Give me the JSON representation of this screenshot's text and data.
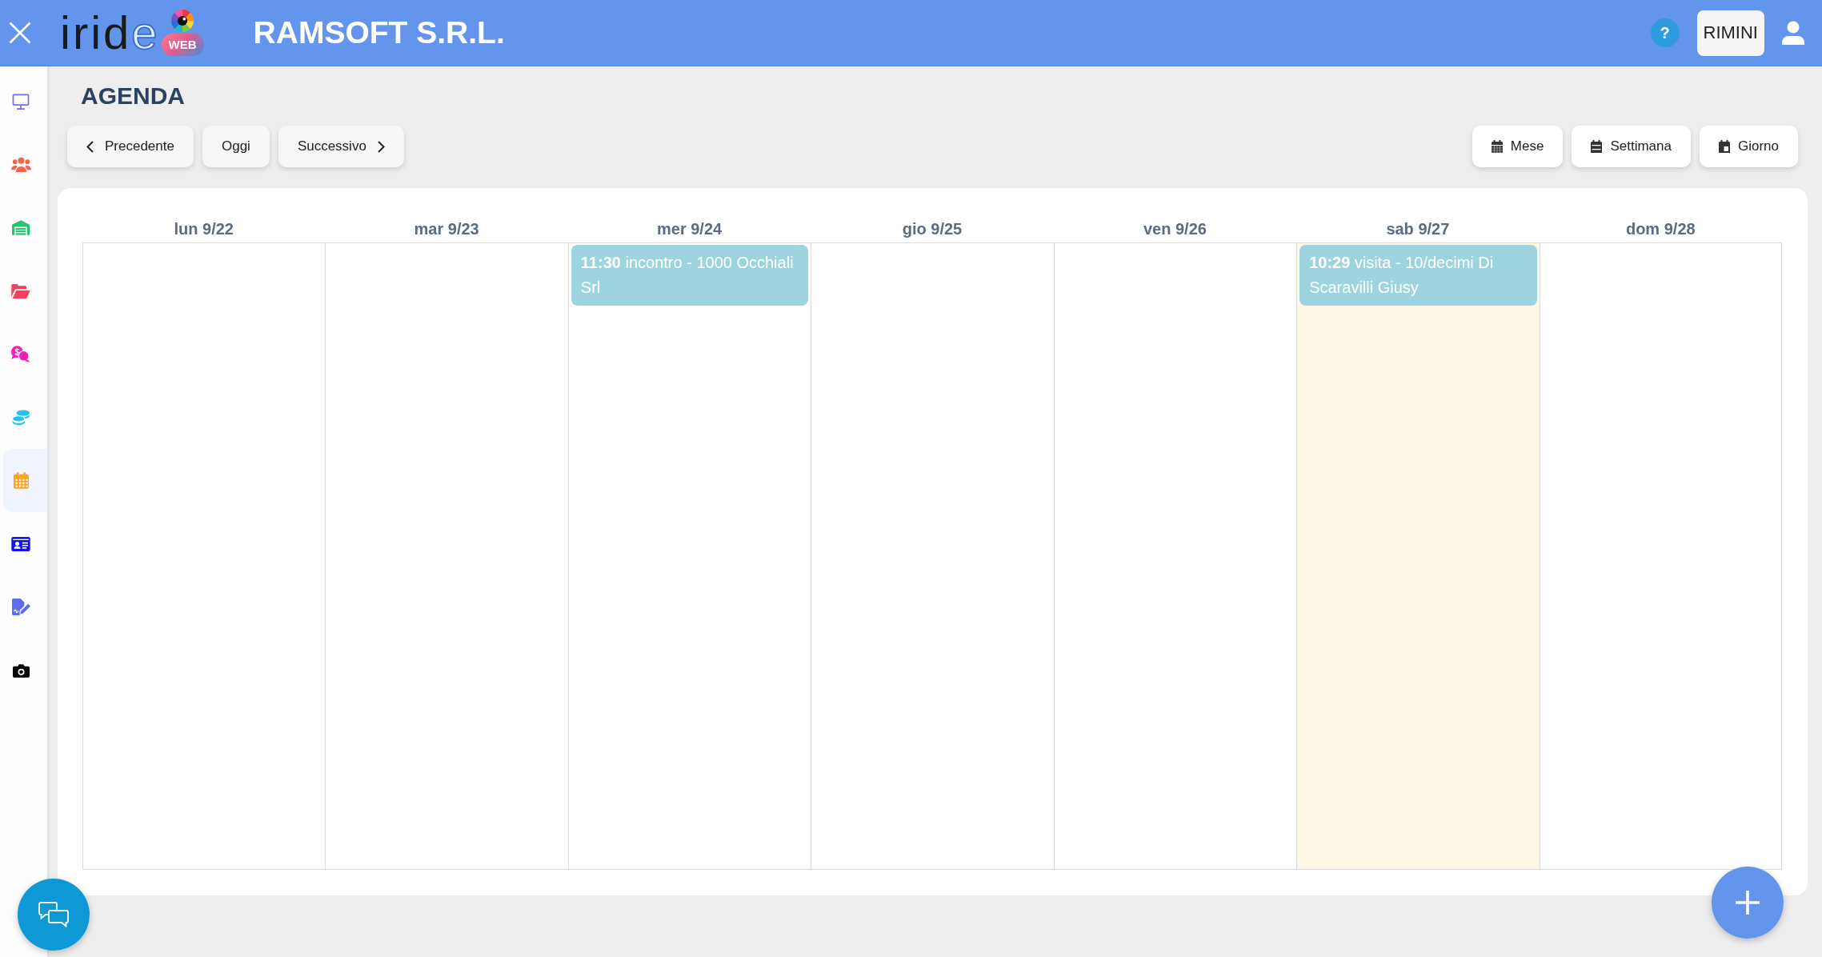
{
  "header": {
    "logo": {
      "wordmark": "iride",
      "badge": "WEB"
    },
    "company": "RAMSOFT S.R.L.",
    "help": "?",
    "branch": "RIMINI"
  },
  "sidebar": {
    "items": [
      {
        "kind": "monitor",
        "color": "#6f6fe6",
        "selected": false
      },
      {
        "kind": "users",
        "color": "#f4644a",
        "selected": false
      },
      {
        "kind": "warehouse",
        "color": "#27c46e",
        "selected": false
      },
      {
        "kind": "folder",
        "color": "#f43f5e",
        "selected": false
      },
      {
        "kind": "payments",
        "color": "#ee1fb8",
        "selected": false
      },
      {
        "kind": "coins",
        "color": "#22c3f0",
        "selected": false
      },
      {
        "kind": "calendar",
        "color": "#ffa31a",
        "selected": true
      },
      {
        "kind": "id-card",
        "color": "#1414e6",
        "selected": false
      },
      {
        "kind": "signature",
        "color": "#5a6cf0",
        "selected": false
      },
      {
        "kind": "camera",
        "color": "#000000",
        "selected": false
      }
    ]
  },
  "page_title": "AGENDA",
  "toolbar": {
    "nav_buttons": [
      {
        "kind": "prev",
        "label": "Precedente"
      },
      {
        "kind": "today",
        "label": "Oggi"
      },
      {
        "kind": "next",
        "label": "Successivo"
      }
    ],
    "view_buttons": [
      {
        "kind": "month",
        "label": "Mese"
      },
      {
        "kind": "week",
        "label": "Settimana"
      },
      {
        "kind": "day",
        "label": "Giorno"
      }
    ]
  },
  "calendar": {
    "days": [
      {
        "label": "lun 9/22",
        "today": false
      },
      {
        "label": "mar 9/23",
        "today": false
      },
      {
        "label": "mer 9/24",
        "today": false,
        "events": [
          {
            "text": "**11:30** incontro - 1000 Occhiali Srl"
          }
        ]
      },
      {
        "label": "gio 9/25",
        "today": false
      },
      {
        "label": "ven 9/26",
        "today": false
      },
      {
        "label": "sab 9/27",
        "today": true,
        "events": [
          {
            "text": "**10:29** visita - 10/decimi Di Scaravilli Giusy"
          }
        ]
      },
      {
        "label": "dom 9/28",
        "today": false
      }
    ]
  }
}
